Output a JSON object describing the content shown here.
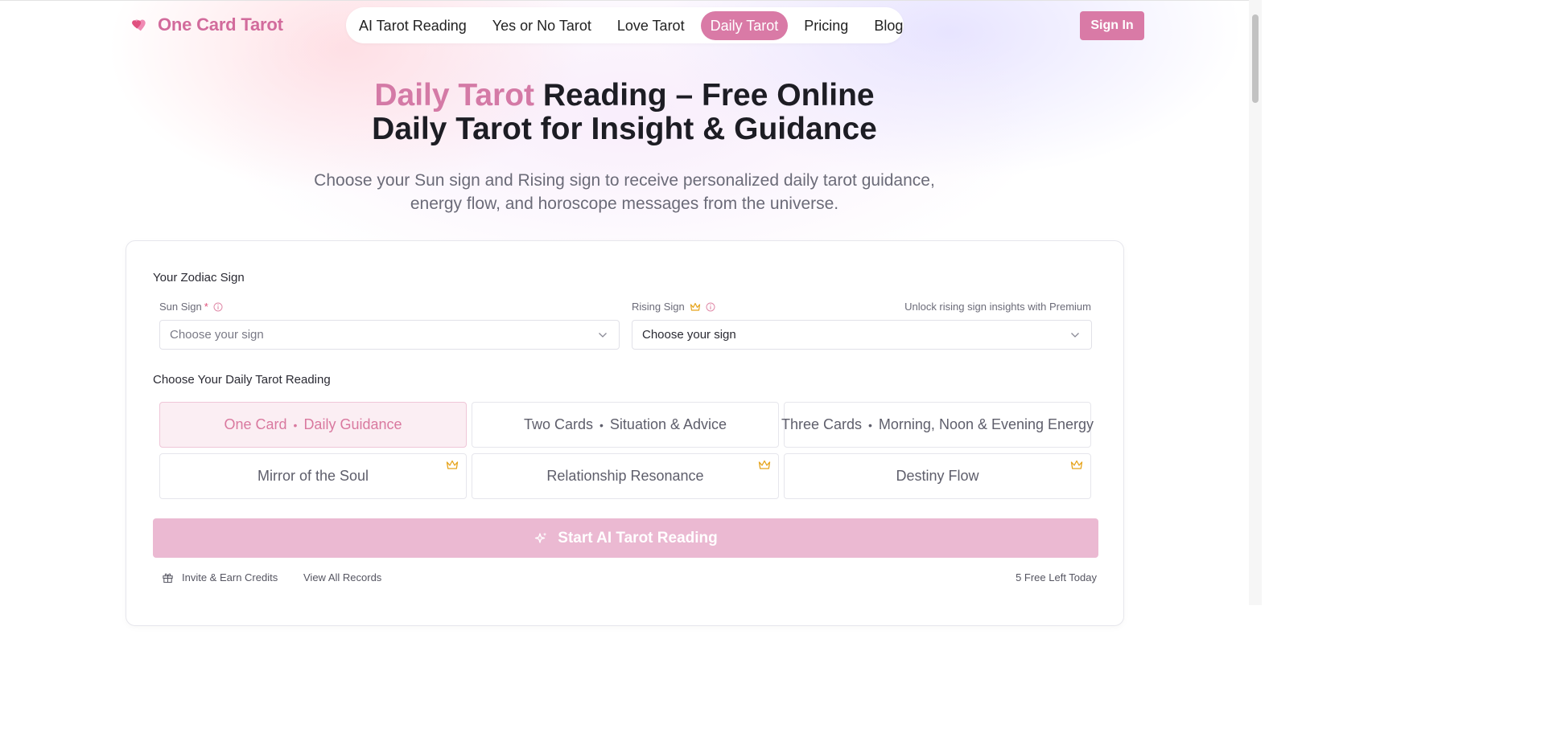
{
  "header": {
    "brand": "One Card Tarot",
    "nav": [
      {
        "label": "AI Tarot Reading",
        "active": false
      },
      {
        "label": "Yes or No Tarot",
        "active": false
      },
      {
        "label": "Love Tarot",
        "active": false
      },
      {
        "label": "Daily Tarot",
        "active": true
      },
      {
        "label": "Pricing",
        "active": false
      },
      {
        "label": "Blog",
        "active": false
      }
    ],
    "sign_in": "Sign In"
  },
  "hero": {
    "title_accent": "Daily Tarot",
    "title_rest_line1": " Reading – Free Online",
    "title_line2": "Daily Tarot for Insight & Guidance",
    "subtitle_line1": "Choose your Sun sign and Rising sign to receive personalized daily tarot guidance,",
    "subtitle_line2": "energy flow, and horoscope messages from the universe."
  },
  "form": {
    "zodiac_heading": "Your Zodiac Sign",
    "sun_sign": {
      "label": "Sun Sign",
      "required_mark": "*",
      "placeholder": "Choose your sign"
    },
    "rising_sign": {
      "label": "Rising Sign",
      "placeholder": "Choose your sign",
      "premium_hint": "Unlock rising sign insights with Premium"
    },
    "reading_heading": "Choose Your Daily Tarot Reading",
    "options": [
      {
        "name": "One Card",
        "detail": "Daily Guidance",
        "selected": true,
        "premium": false
      },
      {
        "name": "Two Cards",
        "detail": "Situation & Advice",
        "selected": false,
        "premium": false
      },
      {
        "name": "Three Cards",
        "detail": "Morning, Noon & Evening Energy",
        "selected": false,
        "premium": false
      },
      {
        "name": "Mirror of the Soul",
        "detail": "",
        "selected": false,
        "premium": true
      },
      {
        "name": "Relationship Resonance",
        "detail": "",
        "selected": false,
        "premium": true
      },
      {
        "name": "Destiny Flow",
        "detail": "",
        "selected": false,
        "premium": true
      }
    ],
    "separator": "•",
    "start_button": "Start AI Tarot Reading",
    "invite_link": "Invite & Earn Credits",
    "records_link": "View All Records",
    "free_left": "5 Free Left Today"
  },
  "colors": {
    "brand_pink": "#d97aa6",
    "start_button_disabled": "#ebb9d2",
    "selected_option_bg": "#fbeef3",
    "crown_gold": "#e6a41c"
  }
}
